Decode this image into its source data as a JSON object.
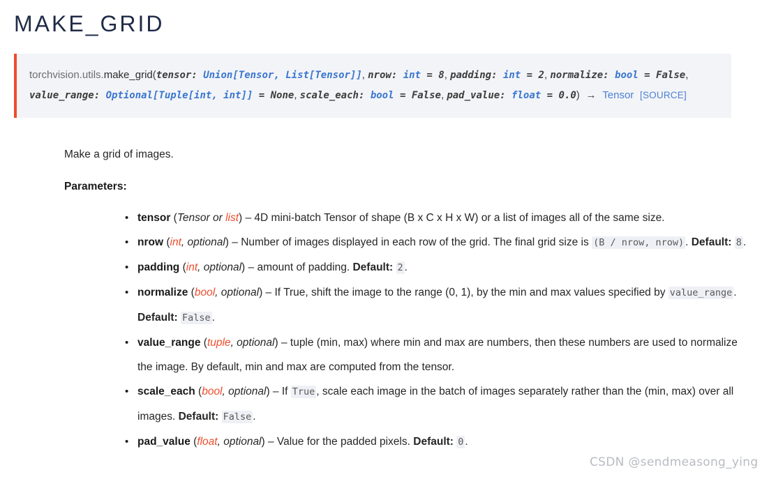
{
  "page": {
    "title": "MAKE_GRID"
  },
  "signature": {
    "module_prefix": "torchvision.utils.",
    "function_name": "make_grid",
    "open_paren": "(",
    "close_paren": ")",
    "return_arrow": "→",
    "return_type": "Tensor",
    "source_link": "[SOURCE]",
    "params": [
      {
        "name": "tensor:",
        "type": "Union[Tensor, List[Tensor]]",
        "eq": "",
        "default": "",
        "sep": ","
      },
      {
        "name": "nrow:",
        "type": "int",
        "eq": "=",
        "default": "8",
        "sep": ","
      },
      {
        "name": "padding:",
        "type": "int",
        "eq": "=",
        "default": "2",
        "sep": ","
      },
      {
        "name": "normalize:",
        "type": "bool",
        "eq": "=",
        "default": "False",
        "sep": ","
      },
      {
        "name": "value_range:",
        "type": "Optional[Tuple[int, int]]",
        "eq": "=",
        "default": "None",
        "sep": ","
      },
      {
        "name": "scale_each:",
        "type": "bool",
        "eq": "=",
        "default": "False",
        "sep": ","
      },
      {
        "name": "pad_value:",
        "type": "float",
        "eq": "=",
        "default": "0.0",
        "sep": ""
      }
    ]
  },
  "body": {
    "summary": "Make a grid of images.",
    "parameters_heading": "Parameters:",
    "parameters": [
      {
        "name": "tensor",
        "types_plain": "Tensor or ",
        "types_red": "list",
        "parts": [
          {
            "kind": "text",
            "text": " – 4D mini-batch Tensor of shape (B x C x H x W) or a list of images all of the same size."
          }
        ]
      },
      {
        "name": "nrow",
        "types_plain": ", optional",
        "types_red": "int",
        "parts": [
          {
            "kind": "text",
            "text": " – Number of images displayed in each row of the grid. The final grid size is "
          },
          {
            "kind": "code",
            "text": "(B / nrow, nrow)"
          },
          {
            "kind": "text",
            "text": ". "
          },
          {
            "kind": "bold",
            "text": "Default:"
          },
          {
            "kind": "text",
            "text": " "
          },
          {
            "kind": "code",
            "text": "8"
          },
          {
            "kind": "text",
            "text": "."
          }
        ]
      },
      {
        "name": "padding",
        "types_plain": ", optional",
        "types_red": "int",
        "parts": [
          {
            "kind": "text",
            "text": " – amount of padding. "
          },
          {
            "kind": "bold",
            "text": "Default:"
          },
          {
            "kind": "text",
            "text": " "
          },
          {
            "kind": "code",
            "text": "2"
          },
          {
            "kind": "text",
            "text": "."
          }
        ]
      },
      {
        "name": "normalize",
        "types_plain": ", optional",
        "types_red": "bool",
        "parts": [
          {
            "kind": "text",
            "text": " – If True, shift the image to the range (0, 1), by the min and max values specified by "
          },
          {
            "kind": "code",
            "text": "value_range"
          },
          {
            "kind": "text",
            "text": ". "
          },
          {
            "kind": "bold",
            "text": "Default:"
          },
          {
            "kind": "text",
            "text": " "
          },
          {
            "kind": "code",
            "text": "False"
          },
          {
            "kind": "text",
            "text": "."
          }
        ]
      },
      {
        "name": "value_range",
        "types_plain": ", optional",
        "types_red": "tuple",
        "parts": [
          {
            "kind": "text",
            "text": " – tuple (min, max) where min and max are numbers, then these numbers are used to normalize the image. By default, min and max are computed from the tensor."
          }
        ]
      },
      {
        "name": "scale_each",
        "types_plain": ", optional",
        "types_red": "bool",
        "parts": [
          {
            "kind": "text",
            "text": " – If "
          },
          {
            "kind": "code",
            "text": "True"
          },
          {
            "kind": "text",
            "text": ", scale each image in the batch of images separately rather than the (min, max) over all images. "
          },
          {
            "kind": "bold",
            "text": "Default:"
          },
          {
            "kind": "text",
            "text": " "
          },
          {
            "kind": "code",
            "text": "False"
          },
          {
            "kind": "text",
            "text": "."
          }
        ]
      },
      {
        "name": "pad_value",
        "types_plain": ", optional",
        "types_red": "float",
        "parts": [
          {
            "kind": "text",
            "text": " – Value for the padded pixels. "
          },
          {
            "kind": "bold",
            "text": "Default:"
          },
          {
            "kind": "text",
            "text": " "
          },
          {
            "kind": "code",
            "text": "0"
          },
          {
            "kind": "text",
            "text": "."
          }
        ]
      }
    ]
  },
  "watermark": {
    "text": "CSDN @sendmeasong_ying"
  },
  "colors": {
    "accent_red": "#ee4c2c",
    "link_blue": "#4a7fd4",
    "type_blue": "#3a76d0",
    "sig_bg": "#f3f4f7",
    "code_bg": "#eef0f5",
    "title": "#1f2b47"
  }
}
